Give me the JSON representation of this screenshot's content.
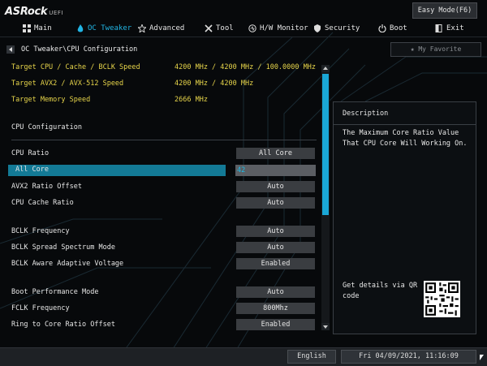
{
  "header": {
    "brand": "ASRock",
    "brand_suffix": "UEFI",
    "easy_mode": "Easy Mode(F6)"
  },
  "nav": [
    {
      "label": "Main",
      "icon": "grid-icon",
      "active": false
    },
    {
      "label": "OC Tweaker",
      "icon": "flame-icon",
      "active": true
    },
    {
      "label": "Advanced",
      "icon": "star-icon",
      "active": false
    },
    {
      "label": "Tool",
      "icon": "tools-icon",
      "active": false
    },
    {
      "label": "H/W Monitor",
      "icon": "monitor-icon",
      "active": false
    },
    {
      "label": "Security",
      "icon": "shield-icon",
      "active": false
    },
    {
      "label": "Boot",
      "icon": "power-icon",
      "active": false
    },
    {
      "label": "Exit",
      "icon": "exit-icon",
      "active": false
    }
  ],
  "breadcrumb": "OC Tweaker\\CPU Configuration",
  "favorite": "My Favorite",
  "targets": [
    {
      "label": "Target CPU / Cache / BCLK Speed",
      "value": "4200 MHz / 4200 MHz / 100.0000 MHz"
    },
    {
      "label": "Target AVX2 / AVX-512 Speed",
      "value": "4200 MHz / 4200 MHz"
    },
    {
      "label": "Target Memory Speed",
      "value": "2666 MHz"
    }
  ],
  "section_title": "CPU Configuration",
  "options": [
    {
      "label": "CPU  Ratio",
      "value": "All Core"
    },
    {
      "label": "All Core",
      "value": "42",
      "selected": true
    },
    {
      "label": "AVX2 Ratio Offset",
      "value": "Auto"
    },
    {
      "label": "CPU  Cache Ratio",
      "value": "Auto"
    },
    {
      "label": "BCLK Frequency",
      "value": "Auto"
    },
    {
      "label": "BCLK Spread Spectrum Mode",
      "value": "Auto"
    },
    {
      "label": "BCLK Aware Adaptive Voltage",
      "value": "Enabled"
    },
    {
      "label": "Boot Performance Mode",
      "value": "Auto"
    },
    {
      "label": "FCLK Frequency",
      "value": "800Mhz"
    },
    {
      "label": "Ring to Core Ratio Offset",
      "value": "Enabled"
    }
  ],
  "description": {
    "title": "Description",
    "text": "The Maximum Core Ratio Value That CPU Core Will Working On.",
    "qr_text": "Get details via QR code"
  },
  "footer": {
    "language": "English",
    "datetime": "Fri 04/09/2021, 11:16:09"
  },
  "colors": {
    "accent": "#21b4e3",
    "target_text": "#e6d44a",
    "selected_bar": "#137a96"
  }
}
